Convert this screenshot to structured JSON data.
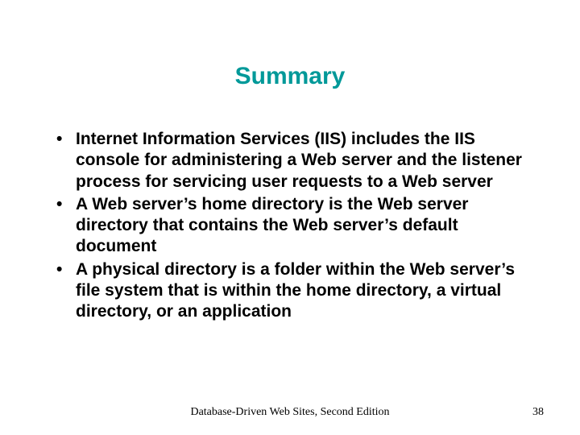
{
  "title": "Summary",
  "bullets": [
    "Internet Information Services (IIS) includes the IIS console for administering a Web server and the listener process for servicing user requests to a Web server",
    "A Web server’s home directory is the Web server directory that contains the Web server’s default document",
    "A physical directory is a folder within the Web server’s file system that is within the home directory, a virtual directory, or an application"
  ],
  "footer": {
    "source": "Database-Driven Web Sites, Second Edition",
    "page": "38"
  }
}
